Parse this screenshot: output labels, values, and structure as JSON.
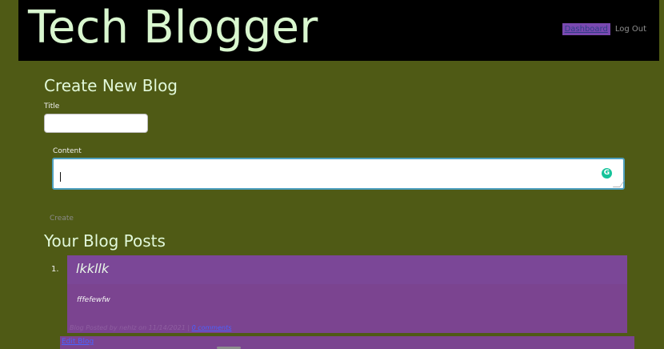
{
  "header": {
    "site_title": "Tech Blogger",
    "nav": {
      "dashboard_label": "Dashboard",
      "logout_label": "Log Out"
    }
  },
  "create_blog": {
    "heading": "Create New Blog",
    "title_label": "Title",
    "title_value": "",
    "content_label": "Content",
    "content_value": "",
    "create_button_label": "Create"
  },
  "blog_posts": {
    "heading": "Your Blog Posts",
    "items": [
      {
        "index": "1.",
        "title": "lkkllk",
        "body": "fffefewfw",
        "meta": "Blog Posted by nehlz on 11/14/2021 |",
        "comments_label": "0 comments",
        "edit_label": "Edit Blog"
      }
    ]
  },
  "colors": {
    "background": "#4f5a15",
    "header": "#000000",
    "accent_purple": "#7b4490",
    "link_blue": "#4a62ff"
  }
}
